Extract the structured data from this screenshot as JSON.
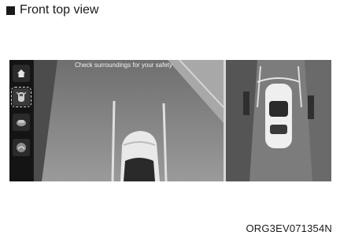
{
  "caption": {
    "title": "Front top view"
  },
  "screen": {
    "warning_text": "Check surroundings for your safety"
  },
  "rail": {
    "items": [
      {
        "icon": "home-icon"
      },
      {
        "icon": "front-view-camera-icon",
        "selected": true
      },
      {
        "icon": "rear-view-camera-icon"
      },
      {
        "icon": "side-view-camera-icon"
      }
    ]
  },
  "figure_code": "ORG3EV071354N"
}
